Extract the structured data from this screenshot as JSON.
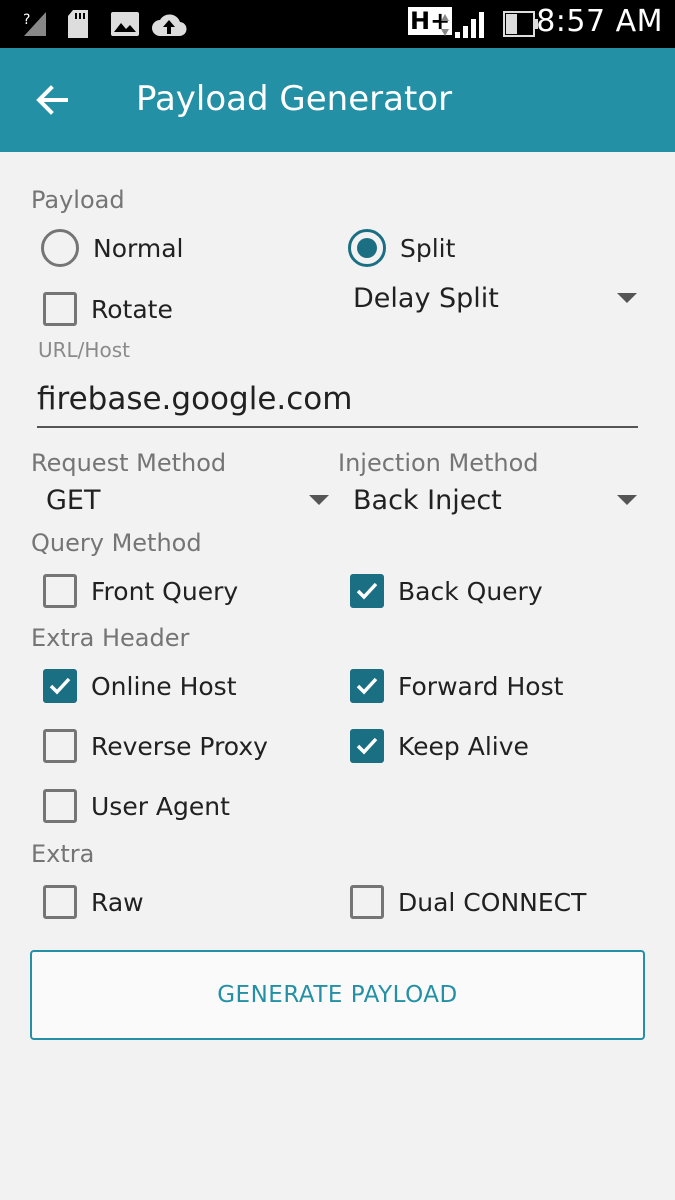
{
  "status_bar": {
    "time": "8:57 AM",
    "network_label": "H+"
  },
  "app_bar": {
    "title": "Payload Generator"
  },
  "payload": {
    "section_label": "Payload",
    "normal_label": "Normal",
    "split_label": "Split",
    "rotate_label": "Rotate",
    "split_mode": "Delay Split",
    "selected": "Split",
    "rotate_checked": false
  },
  "url": {
    "label": "URL/Host",
    "value": "firebase.google.com"
  },
  "request_method": {
    "label": "Request Method",
    "value": "GET"
  },
  "injection_method": {
    "label": "Injection Method",
    "value": "Back Inject"
  },
  "query_method": {
    "section_label": "Query Method",
    "front_query": {
      "label": "Front Query",
      "checked": false
    },
    "back_query": {
      "label": "Back Query",
      "checked": true
    }
  },
  "extra_header": {
    "section_label": "Extra Header",
    "online_host": {
      "label": "Online Host",
      "checked": true
    },
    "forward_host": {
      "label": "Forward Host",
      "checked": true
    },
    "reverse_proxy": {
      "label": "Reverse Proxy",
      "checked": false
    },
    "keep_alive": {
      "label": "Keep Alive",
      "checked": true
    },
    "user_agent": {
      "label": "User Agent",
      "checked": false
    }
  },
  "extra": {
    "section_label": "Extra",
    "raw": {
      "label": "Raw",
      "checked": false
    },
    "dual_connect": {
      "label": "Dual CONNECT",
      "checked": false
    }
  },
  "generate_button": {
    "label": "GENERATE PAYLOAD"
  },
  "colors": {
    "accent": "#2390a5",
    "control_active": "#1b6f83",
    "background": "#f2f2f2"
  }
}
